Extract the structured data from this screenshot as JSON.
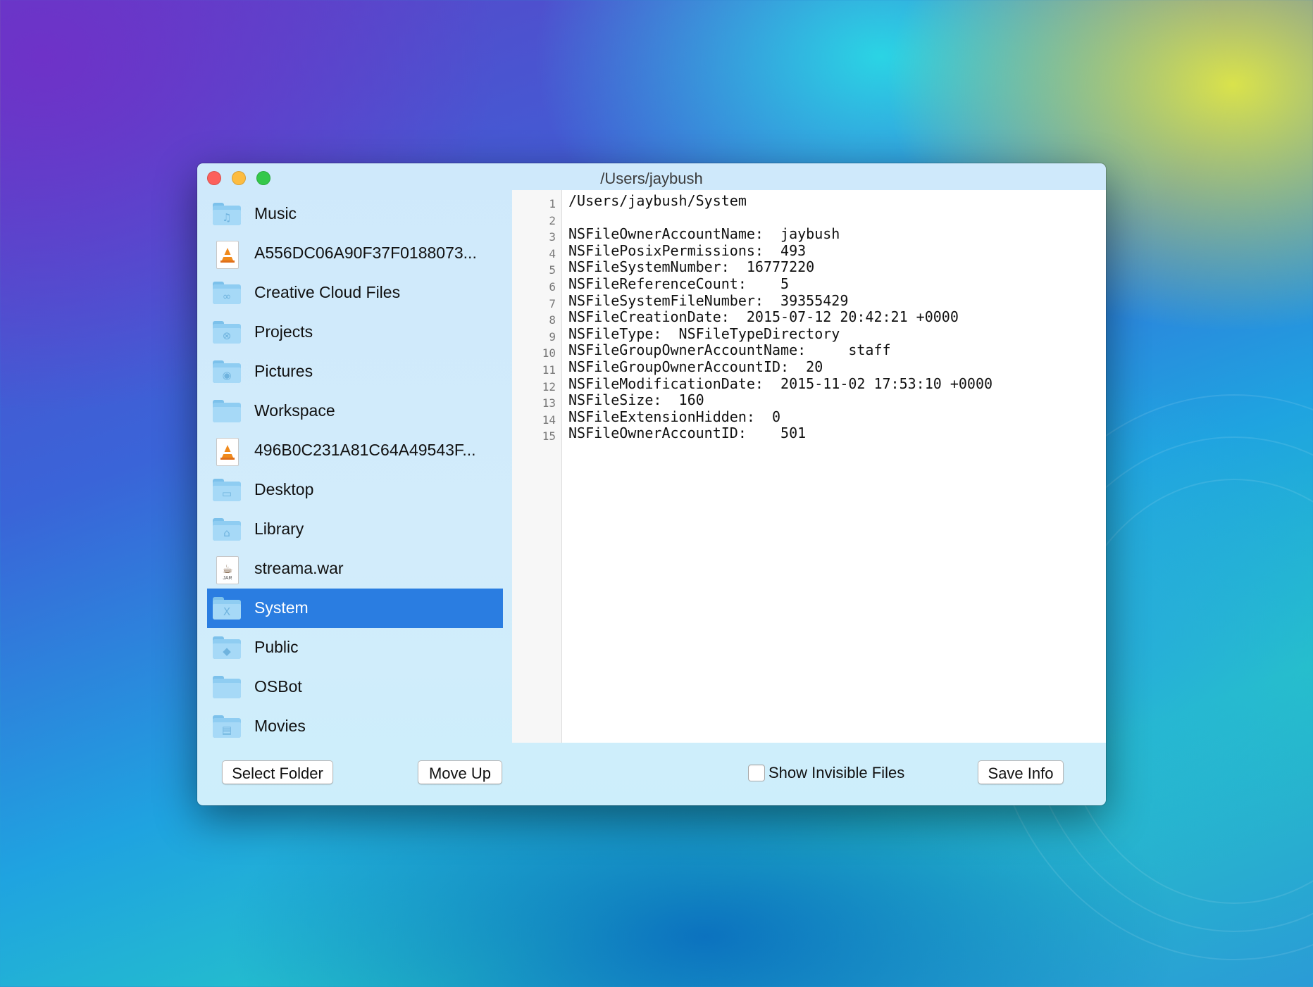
{
  "window": {
    "title": "/Users/jaybush"
  },
  "sidebar": {
    "items": [
      {
        "label": "Music",
        "icon": "music-folder-icon",
        "kind": "folder",
        "glyph": "♫",
        "selected": false
      },
      {
        "label": "A556DC06A90F37F0188073...",
        "icon": "vlc-document-icon",
        "kind": "vlc",
        "glyph": "",
        "selected": false
      },
      {
        "label": "Creative Cloud Files",
        "icon": "creative-cloud-folder-icon",
        "kind": "folder",
        "glyph": "∞",
        "selected": false
      },
      {
        "label": "Projects",
        "icon": "projects-folder-icon",
        "kind": "folder",
        "glyph": "⊗",
        "selected": false
      },
      {
        "label": "Pictures",
        "icon": "pictures-folder-icon",
        "kind": "folder",
        "glyph": "◉",
        "selected": false
      },
      {
        "label": "Workspace",
        "icon": "workspace-folder-icon",
        "kind": "folder",
        "glyph": "",
        "selected": false
      },
      {
        "label": "496B0C231A81C64A49543F...",
        "icon": "vlc-document-icon",
        "kind": "vlc",
        "glyph": "",
        "selected": false
      },
      {
        "label": "Desktop",
        "icon": "desktop-folder-icon",
        "kind": "folder",
        "glyph": "▭",
        "selected": false
      },
      {
        "label": "Library",
        "icon": "library-folder-icon",
        "kind": "folder",
        "glyph": "⌂",
        "selected": false
      },
      {
        "label": "streama.war",
        "icon": "jar-document-icon",
        "kind": "jar",
        "glyph": "☕",
        "selected": false
      },
      {
        "label": "System",
        "icon": "system-folder-icon",
        "kind": "folder",
        "glyph": "X",
        "selected": true
      },
      {
        "label": "Public",
        "icon": "public-folder-icon",
        "kind": "folder",
        "glyph": "◆",
        "selected": false
      },
      {
        "label": "OSBot",
        "icon": "osbot-folder-icon",
        "kind": "folder",
        "glyph": "",
        "selected": false
      },
      {
        "label": "Movies",
        "icon": "movies-folder-icon",
        "kind": "folder",
        "glyph": "▤",
        "selected": false
      }
    ]
  },
  "editor": {
    "lines": [
      "/Users/jaybush/System",
      "",
      "NSFileOwnerAccountName:  jaybush",
      "NSFilePosixPermissions:  493",
      "NSFileSystemNumber:  16777220",
      "NSFileReferenceCount:    5",
      "NSFileSystemFileNumber:  39355429",
      "NSFileCreationDate:  2015-07-12 20:42:21 +0000",
      "NSFileType:  NSFileTypeDirectory",
      "NSFileGroupOwnerAccountName:     staff",
      "NSFileGroupOwnerAccountID:  20",
      "NSFileModificationDate:  2015-11-02 17:53:10 +0000",
      "NSFileSize:  160",
      "NSFileExtensionHidden:  0",
      "NSFileOwnerAccountID:    501"
    ]
  },
  "toolbar": {
    "select_folder_label": "Select Folder",
    "move_up_label": "Move Up",
    "show_invisible_label": "Show Invisible Files",
    "show_invisible_checked": false,
    "save_info_label": "Save Info"
  },
  "colors": {
    "selection": "#2a7de1",
    "close": "#fc605c",
    "minimize": "#fdbc40",
    "zoom": "#34c84a"
  }
}
